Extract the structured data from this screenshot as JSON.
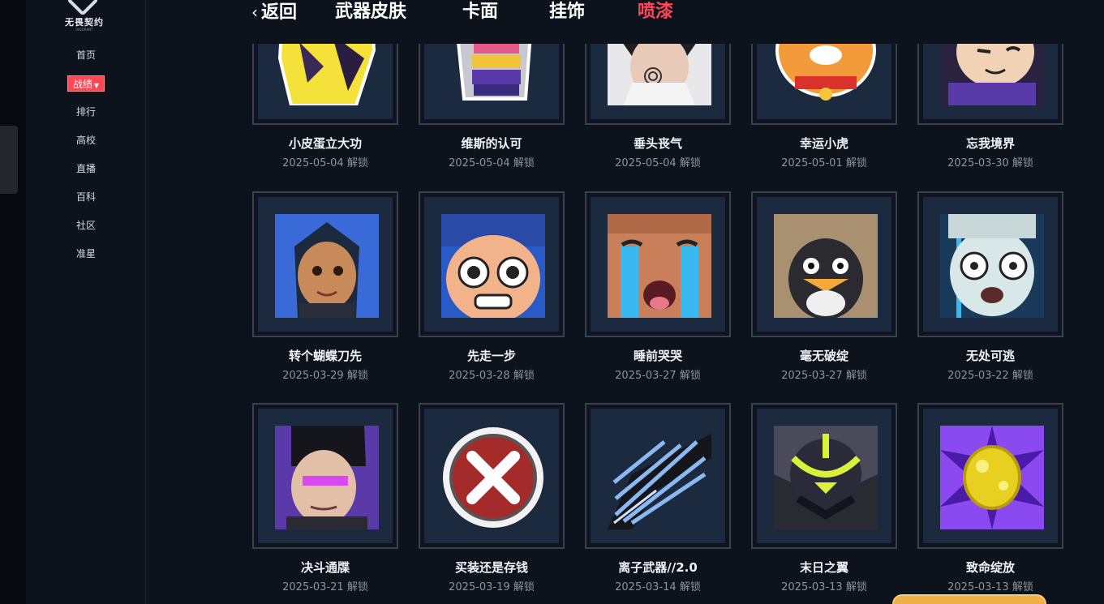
{
  "app": {
    "logo_text": "无畏契约",
    "logo_sub": "VALORANT"
  },
  "sidebar": {
    "items": [
      {
        "label": "首页"
      },
      {
        "label": "战绩",
        "active": true
      },
      {
        "label": "排行"
      },
      {
        "label": "高校"
      },
      {
        "label": "直播"
      },
      {
        "label": "百科"
      },
      {
        "label": "社区"
      },
      {
        "label": "准星"
      }
    ],
    "active_color": "#ff4655"
  },
  "topnav": {
    "back_label": "返回",
    "tabs": [
      {
        "label": "武器皮肤"
      },
      {
        "label": "卡面"
      },
      {
        "label": "挂饰"
      },
      {
        "label": "喷漆",
        "active": true
      }
    ],
    "active_color": "#ff4655"
  },
  "unlock_suffix": "解锁",
  "sprays": [
    {
      "name": "小皮蛋立大功",
      "date": "2025-05-04",
      "status": "解锁",
      "icon": "yellow-creature-icon"
    },
    {
      "name": "维斯的认可",
      "date": "2025-05-04",
      "status": "解锁",
      "icon": "fist-icon"
    },
    {
      "name": "垂头丧气",
      "date": "2025-05-04",
      "status": "解锁",
      "icon": "sad-agent-icon"
    },
    {
      "name": "幸运小虎",
      "date": "2025-05-01",
      "status": "解锁",
      "icon": "lucky-tiger-icon"
    },
    {
      "name": "忘我境界",
      "date": "2025-03-30",
      "status": "解锁",
      "icon": "blissful-agent-icon"
    },
    {
      "name": "转个蝴蝶刀先",
      "date": "2025-03-29",
      "status": "解锁",
      "icon": "blue-hair-agent-icon"
    },
    {
      "name": "先走一步",
      "date": "2025-03-28",
      "status": "解锁",
      "icon": "shocked-agent-icon"
    },
    {
      "name": "睡前哭哭",
      "date": "2025-03-27",
      "status": "解锁",
      "icon": "crying-face-icon"
    },
    {
      "name": "毫无破绽",
      "date": "2025-03-27",
      "status": "解锁",
      "icon": "penguin-icon"
    },
    {
      "name": "无处可逃",
      "date": "2025-03-22",
      "status": "解锁",
      "icon": "scared-agent-icon"
    },
    {
      "name": "决斗通牒",
      "date": "2025-03-21",
      "status": "解锁",
      "icon": "duelist-agent-icon"
    },
    {
      "name": "买装还是存钱",
      "date": "2025-03-19",
      "status": "解锁",
      "icon": "red-x-icon"
    },
    {
      "name": "离子武器//2.0",
      "date": "2025-03-14",
      "status": "解锁",
      "icon": "ion-wing-icon"
    },
    {
      "name": "末日之翼",
      "date": "2025-03-13",
      "status": "解锁",
      "icon": "doom-wing-icon"
    },
    {
      "name": "致命绽放",
      "date": "2025-03-13",
      "status": "解锁",
      "icon": "golden-bloom-icon"
    }
  ]
}
